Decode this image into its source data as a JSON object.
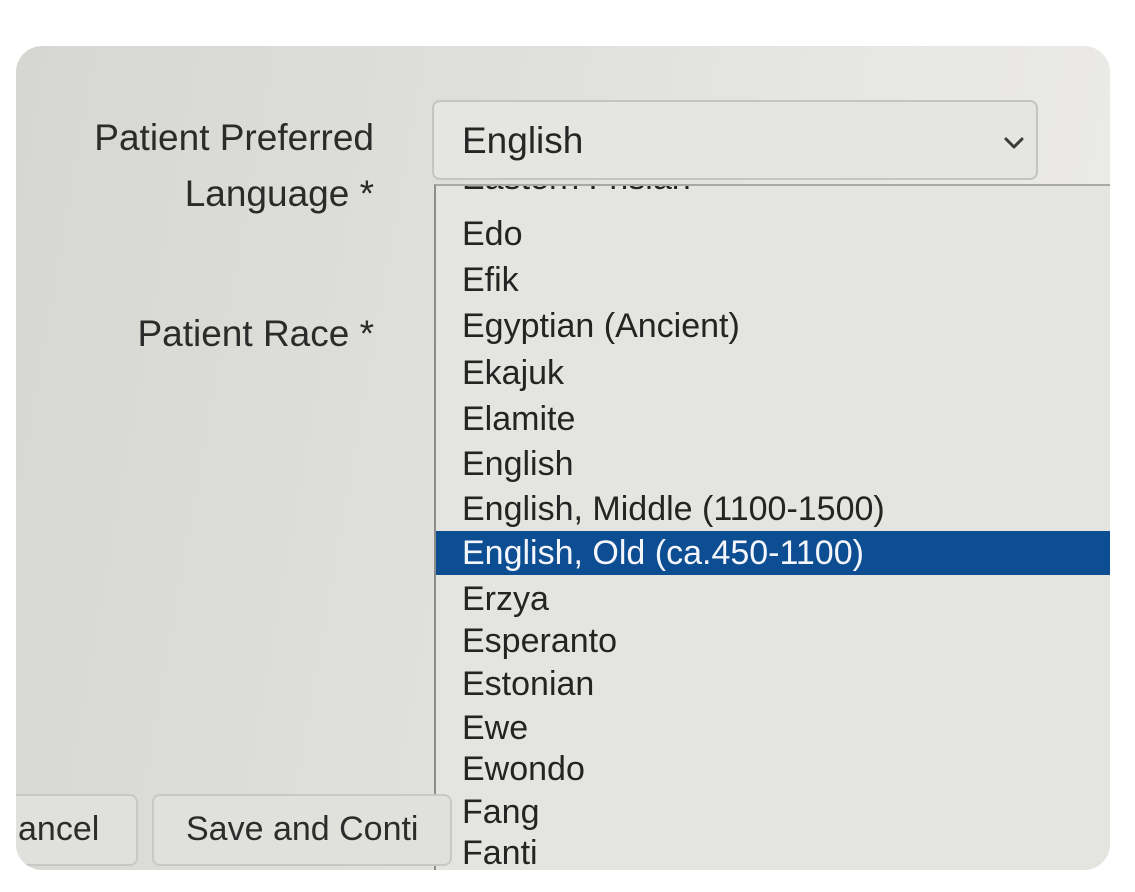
{
  "form": {
    "language_label_line1": "Patient Preferred",
    "language_label_line2": "Language *",
    "race_label": "Patient Race *"
  },
  "language_select": {
    "selected_value": "English",
    "icon": "chevron-down-icon",
    "options": [
      "Eastern Frisian",
      "Edo",
      "Efik",
      "Egyptian (Ancient)",
      "Ekajuk",
      "Elamite",
      "English",
      "English, Middle (1100-1500)",
      "English, Old (ca.450-1100)",
      "Erzya",
      "Esperanto",
      "Estonian",
      "Ewe",
      "Ewondo",
      "Fang",
      "Fanti"
    ],
    "highlighted_option": "English, Old (ca.450-1100)",
    "highlight_color": "#0d4d92"
  },
  "buttons": {
    "cancel_label": "ancel",
    "save_label": "Save and Conti"
  }
}
